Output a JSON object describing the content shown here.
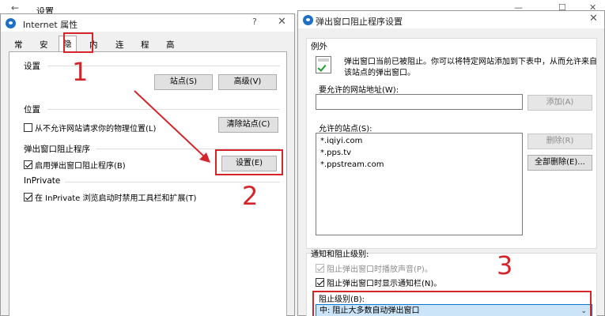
{
  "background": {
    "title": "设置",
    "back_icon": "back-arrow-icon",
    "controls": [
      "—",
      "☐",
      "✕"
    ]
  },
  "dialog1": {
    "title": "Internet 属性",
    "help": "?",
    "close": "✕",
    "tabs": [
      "常规",
      "安全",
      "隐私",
      "内容",
      "连接",
      "程序",
      "高级"
    ],
    "active_tab": "隐私",
    "settings_group": "设置",
    "sites_button": "站点(S)",
    "advanced_button": "高级(V)",
    "location_group": "位置",
    "location_checkbox": "从不允许网站请求你的物理位置(L)",
    "clear_sites_button": "清除站点(C)",
    "popup_group": "弹出窗口阻止程序",
    "popup_checkbox": "启用弹出窗口阻止程序(B)",
    "popup_settings_button": "设置(E)",
    "inprivate_group": "InPrivate",
    "inprivate_checkbox": "在 InPrivate 浏览启动时禁用工具栏和扩展(T)"
  },
  "dialog2": {
    "title": "弹出窗口阻止程序设置",
    "close": "✕",
    "exceptions_group": "例外",
    "info_line1": "弹出窗口当前已被阻止。你可以将特定网站添加到下表中，从而允许来自",
    "info_line2": "该站点的弹出窗口。",
    "address_label": "要允许的网站地址(W):",
    "address_value": "",
    "add_button": "添加(A)",
    "allowed_label": "允许的站点(S):",
    "allowed_sites": [
      "*.iqiyi.com",
      "*.pps.tv",
      "*.ppstream.com"
    ],
    "remove_button": "删除(R)",
    "remove_all_button": "全部删除(E)...",
    "notify_group": "通知和阻止级别:",
    "sound_checkbox": "阻止弹出窗口时播放声音(P)。",
    "notify_checkbox": "阻止弹出窗口时显示通知栏(N)。",
    "level_label": "阻止级别(B):",
    "level_value": "中: 阻止大多数自动弹出窗口"
  },
  "annotations": [
    "1",
    "2",
    "3"
  ],
  "colors": {
    "annotation_red": "#d4252b",
    "selection_blue": "#cce4f7",
    "ie_blue": "#1f6fc5"
  }
}
